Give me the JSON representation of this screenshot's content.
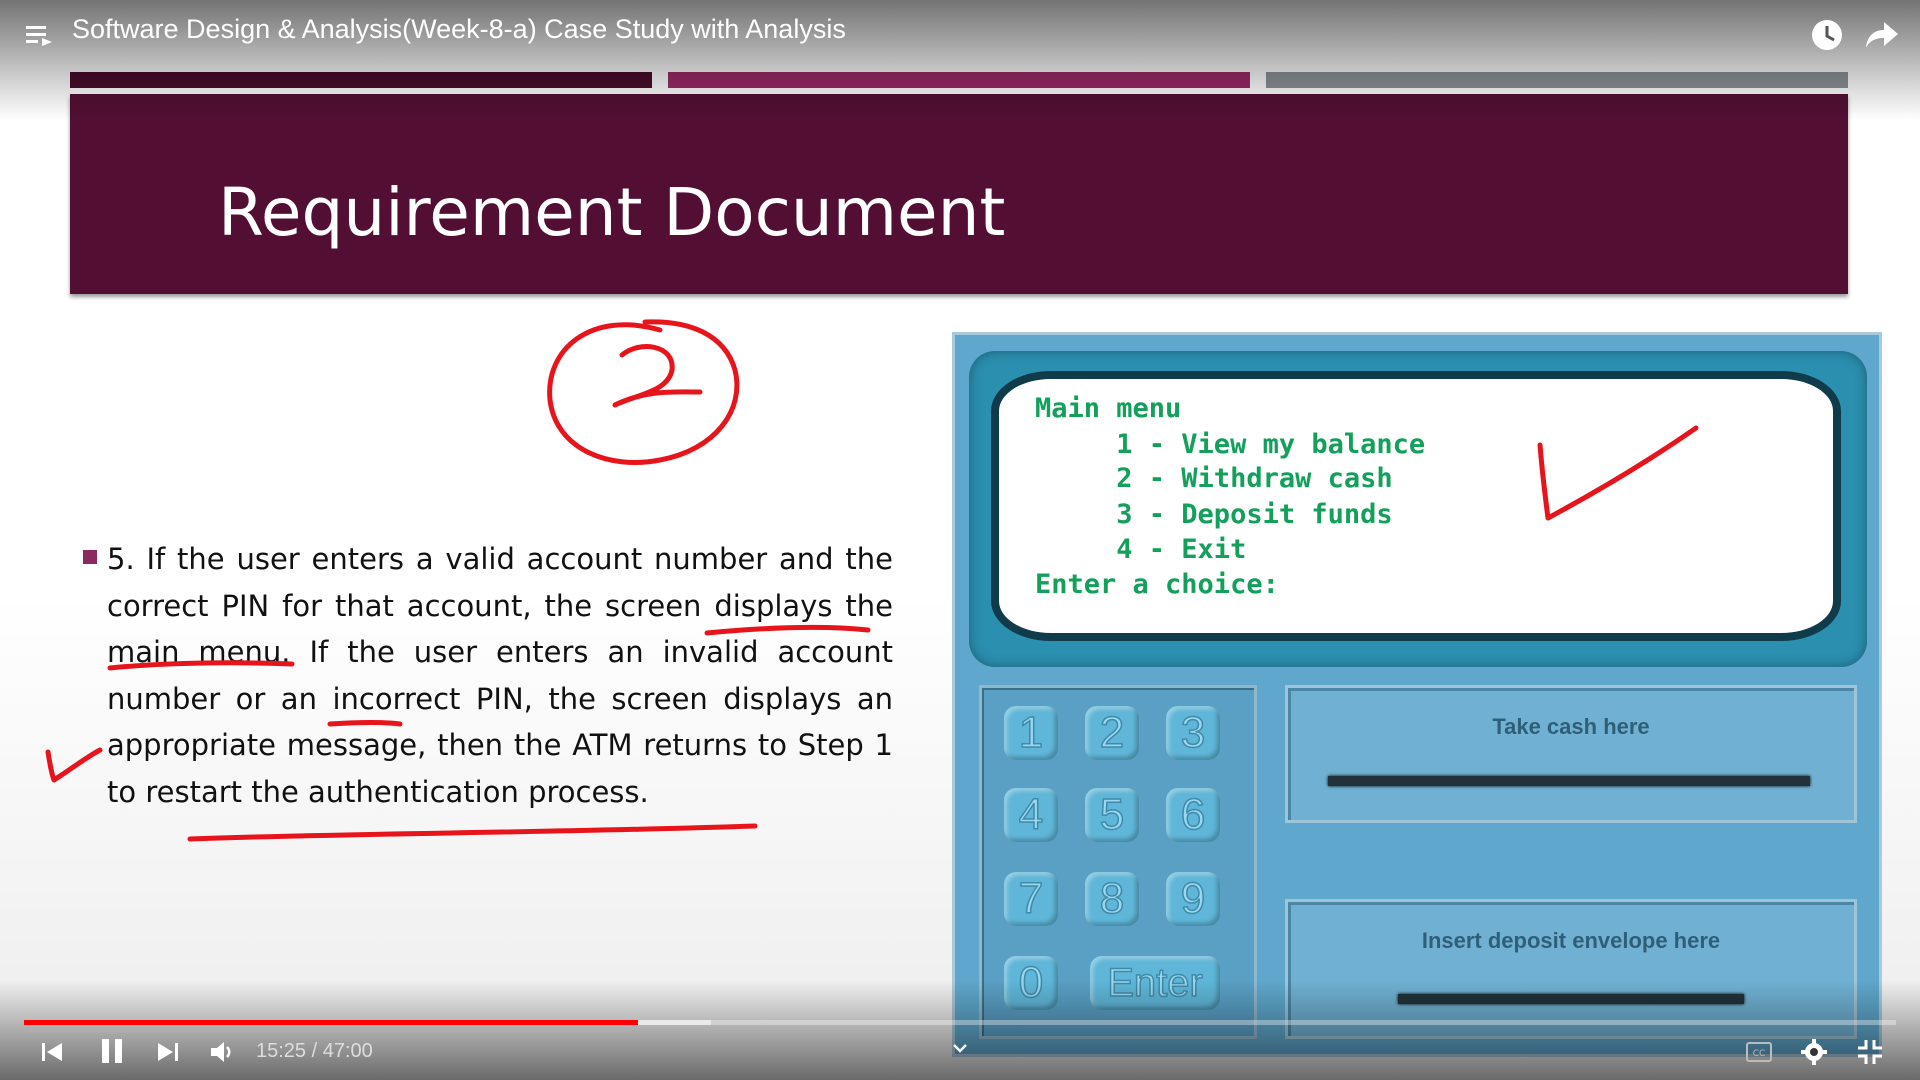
{
  "player": {
    "title": "Software Design & Analysis(Week-8-a) Case Study with Analysis",
    "time": "15:25 / 47:00",
    "progress_played_fraction": 0.328,
    "progress_buffered_fraction": 0.367,
    "icons": [
      "playlist-icon",
      "clock-icon",
      "share-icon",
      "previous-icon",
      "pause-icon",
      "next-icon",
      "volume-icon",
      "chevron-down-icon",
      "captions-icon",
      "settings-icon",
      "exit-fullscreen-icon"
    ]
  },
  "slide": {
    "title": "Requirement Document",
    "colors": {
      "band": "#520f33",
      "bar1": "#4a0c2c",
      "bar2": "#9c2a69",
      "bar3": "#8d9399",
      "annotation": "#e8141c"
    },
    "paragraph": "5. If the user enters a valid account number and the correct PIN for that account, the screen displays the main menu. If the user enters an invalid account number or an incorrect PIN, the screen displays an appropriate message, then the ATM returns to Step 1 to restart the authentication process."
  },
  "atm": {
    "screen_lines": [
      "Main menu",
      "     1 - View my balance",
      "     2 - Withdraw cash",
      "     3 - Deposit funds",
      "     4 - Exit",
      "Enter a choice:"
    ],
    "keys": [
      "1",
      "2",
      "3",
      "4",
      "5",
      "6",
      "7",
      "8",
      "9",
      "0",
      "Enter"
    ],
    "take_cash_label": "Take cash here",
    "deposit_label": "Insert deposit envelope here"
  }
}
